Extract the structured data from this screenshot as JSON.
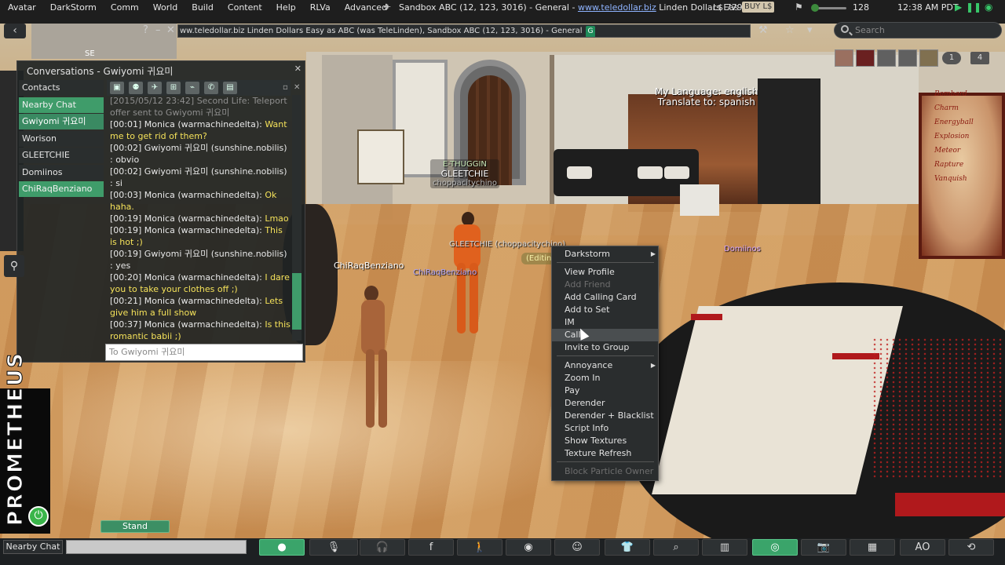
{
  "menubar": {
    "items": [
      "Avatar",
      "DarkStorm",
      "Comm",
      "World",
      "Build",
      "Content",
      "Help",
      "RLVa",
      "Advanced"
    ],
    "location": "Sandbox ABC (12, 123, 3016) - General - ",
    "location_link": "www.teledollar.biz",
    "location_tail": " Linden Dollars Eas",
    "balance": "L$ 779",
    "buy_label": "BUY L$",
    "fps": "128",
    "time": "12:38 AM PDT"
  },
  "navbar": {
    "url": "ww.teledollar.biz Linden Dollars Easy as ABC (was TeleLinden), Sandbox ABC (12, 123, 3016) - General",
    "badge": "G",
    "search_placeholder": "Search",
    "minimap_label": "SE"
  },
  "conversations": {
    "title": "Conversations - Gwiyomi 귀요미",
    "tabs": [
      {
        "label": "Contacts",
        "style": "plain"
      },
      {
        "label": "Nearby Chat",
        "style": "green"
      },
      {
        "label": "Gwiyomi 귀요미",
        "style": "active"
      },
      {
        "label": "Worison",
        "style": "plain"
      },
      {
        "label": "GLEETCHIE",
        "style": "plain"
      },
      {
        "label": "Domiinos",
        "style": "plain"
      },
      {
        "label": "ChiRaqBenziano",
        "style": "green"
      }
    ],
    "messages": [
      {
        "time": "[2015/05/12 23:42]",
        "sender": "Second Life: Teleport offer sent to Gwiyomi 귀요미",
        "text": "",
        "yellow": false,
        "system": true
      },
      {
        "time": "[00:01]",
        "sender": "Monica (warmachinedelta):",
        "text": "Want me to get rid of them?",
        "yellow": true,
        "system": false
      },
      {
        "time": "[00:02]",
        "sender": "Gwiyomi 귀요미 (sunshine.nobilis)",
        "text": ": obvio",
        "yellow": false,
        "system": false
      },
      {
        "time": "[00:02]",
        "sender": "Gwiyomi 귀요미 (sunshine.nobilis)",
        "text": ": si",
        "yellow": false,
        "system": false
      },
      {
        "time": "[00:03]",
        "sender": "Monica (warmachinedelta):",
        "text": "Ok haha.",
        "yellow": true,
        "system": false
      },
      {
        "time": "[00:19]",
        "sender": "Monica (warmachinedelta):",
        "text": "Lmao",
        "yellow": true,
        "system": false
      },
      {
        "time": "[00:19]",
        "sender": "Monica (warmachinedelta):",
        "text": "This is hot ;)",
        "yellow": true,
        "system": false
      },
      {
        "time": "[00:19]",
        "sender": "Gwiyomi 귀요미 (sunshine.nobilis)",
        "text": ": yes",
        "yellow": false,
        "system": false
      },
      {
        "time": "[00:20]",
        "sender": "Monica (warmachinedelta):",
        "text": "I dare you to take your clothes off ;)",
        "yellow": true,
        "system": false
      },
      {
        "time": "[00:21]",
        "sender": "Monica (warmachinedelta):",
        "text": "Lets give him a full show",
        "yellow": true,
        "system": false
      },
      {
        "time": "[00:37]",
        "sender": "Monica (warmachinedelta):",
        "text": "Is this romantic babii ;)",
        "yellow": true,
        "system": false
      }
    ],
    "input_placeholder": "To Gwiyomi 귀요미"
  },
  "scene": {
    "language_line1": "My Language: english",
    "language_line2": "Translate to: spanish",
    "tag_group": "E-THUGGIN",
    "tag_name": "GLEETCHIE",
    "tag_user": "choppacitychino",
    "tag_gleetchie_small": "GLEETCHIE (choppacitychino)",
    "editing": "(Editing Appearance)",
    "tag_chiraq": "ChiRaqBenziano",
    "tag_chiraq_small": "ChiRaqBenziano",
    "tag_domiinos": "Domiinos",
    "poster_lines": [
      "Bombard",
      "Charm",
      "Energyball",
      "Explosion",
      "Meteor",
      "Rapture",
      "Vanquish"
    ]
  },
  "context_menu": {
    "items": [
      {
        "label": "Darkstorm",
        "submenu": true,
        "disabled": false
      },
      {
        "label": "View Profile",
        "submenu": false,
        "disabled": false
      },
      {
        "label": "Add Friend",
        "submenu": false,
        "disabled": true
      },
      {
        "label": "Add Calling Card",
        "submenu": false,
        "disabled": false
      },
      {
        "label": "Add to Set",
        "submenu": false,
        "disabled": false
      },
      {
        "label": "IM",
        "submenu": false,
        "disabled": false
      },
      {
        "label": "Call",
        "submenu": false,
        "disabled": false,
        "hover": true
      },
      {
        "label": "Invite to Group",
        "submenu": false,
        "disabled": false
      },
      {
        "label": "Annoyance",
        "submenu": true,
        "disabled": false
      },
      {
        "label": "Zoom In",
        "submenu": false,
        "disabled": false
      },
      {
        "label": "Pay",
        "submenu": false,
        "disabled": false
      },
      {
        "label": "Derender",
        "submenu": false,
        "disabled": false
      },
      {
        "label": "Derender + Blacklist",
        "submenu": false,
        "disabled": false
      },
      {
        "label": "Script Info",
        "submenu": false,
        "disabled": false
      },
      {
        "label": "Show Textures",
        "submenu": false,
        "disabled": false
      },
      {
        "label": "Texture Refresh",
        "submenu": false,
        "disabled": false
      },
      {
        "label": "Block Particle Owner",
        "submenu": false,
        "disabled": true
      }
    ]
  },
  "top_right": {
    "pill1": "1",
    "pill2": "4"
  },
  "logo": {
    "text": "PROMETHEUS"
  },
  "stand_label": "Stand",
  "bottombar": {
    "nearby_label": "Nearby Chat",
    "ao_label": "AO"
  },
  "colors": {
    "accent_green": "#3aa46a",
    "chat_yellow": "#f5e25a",
    "link_blue": "#8fb4ff"
  }
}
